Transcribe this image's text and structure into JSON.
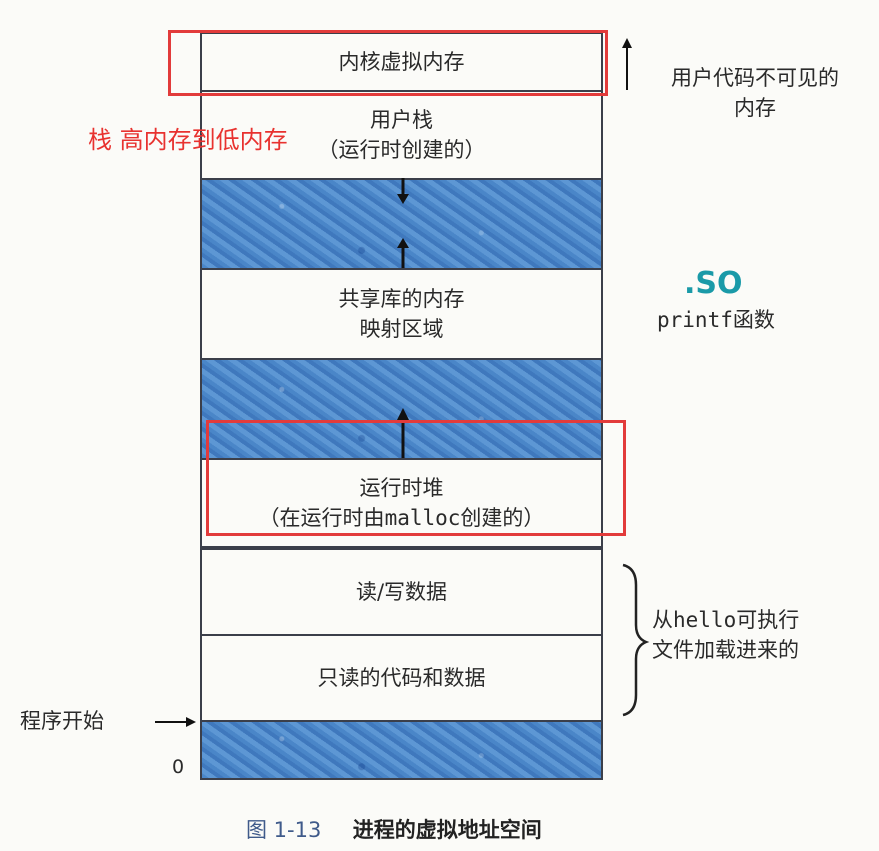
{
  "memory_blocks": {
    "kernel": "内核虚拟内存",
    "user_stack_line1": "用户栈",
    "user_stack_line2": "（运行时创建的）",
    "shared_line1": "共享库的内存",
    "shared_line2": "映射区域",
    "heap_line1": "运行时堆",
    "heap_line2_pre": "（在运行时由",
    "heap_line2_code": "malloc",
    "heap_line2_post": "创建的）",
    "rw_data": "读/写数据",
    "ro_code": "只读的代码和数据"
  },
  "side_notes": {
    "user_invisible_line1": "用户代码不可见的",
    "user_invisible_line2": "内存",
    "so_label": ".SO",
    "printf_code": "printf",
    "printf_suffix": "函数",
    "hello_line1_pre": "从",
    "hello_line1_code": "hello",
    "hello_line1_post": "可执行",
    "hello_line2": "文件加载进来的",
    "program_start": "程序开始",
    "zero": "0"
  },
  "annotations": {
    "stack_note": "栈 高内存到低内存"
  },
  "caption": {
    "number": "图 1-13",
    "title": "进程的虚拟地址空间"
  },
  "colors": {
    "region_blue": "#4a86c8",
    "annotation_red": "#e23b3b",
    "so_teal": "#1a9aa8",
    "caption_blue": "#3f5a8a"
  }
}
